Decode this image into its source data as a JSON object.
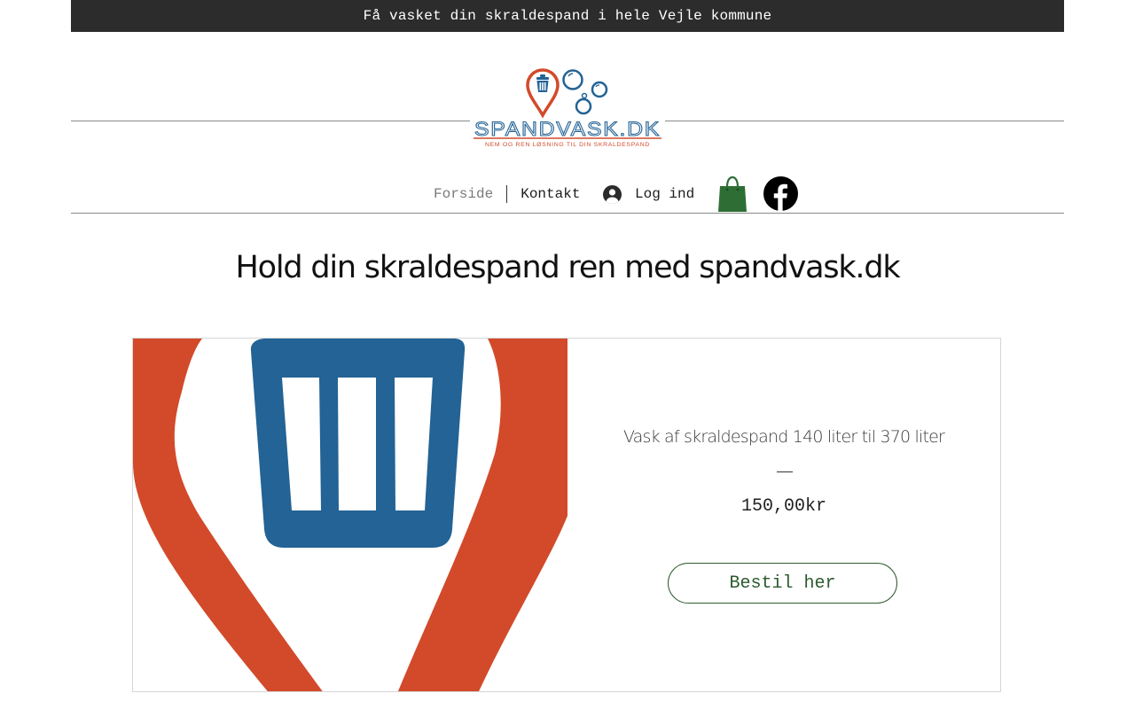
{
  "announcement": {
    "text": "Få vasket din skraldespand i hele Vejle kommune"
  },
  "logo": {
    "wordmark": "SPANDVASK.DK",
    "tagline": "NEM OG REN LØSNING TIL DIN SKRALDESPAND"
  },
  "nav": {
    "items": [
      {
        "label": "Forside",
        "active": true
      },
      {
        "label": "Kontakt",
        "active": false
      }
    ],
    "login_label": "Log ind"
  },
  "page": {
    "heading": "Hold din skraldespand ren med spandvask.dk"
  },
  "product": {
    "title": "Vask af skraldespand 140 liter til 370 liter",
    "price": "150,00kr",
    "button_label": "Bestil her"
  },
  "icons": {
    "user": "avatar-icon",
    "cart": "shopping-bag-icon",
    "social": "facebook-icon",
    "logo_mark": "location-pin-trash-bubbles-icon"
  },
  "colors": {
    "topbar_bg": "#2c2c2c",
    "brand_red": "#d24a2a",
    "brand_blue": "#236395",
    "button_green": "#2c5a2e",
    "cart_green": "#2e6e34"
  }
}
